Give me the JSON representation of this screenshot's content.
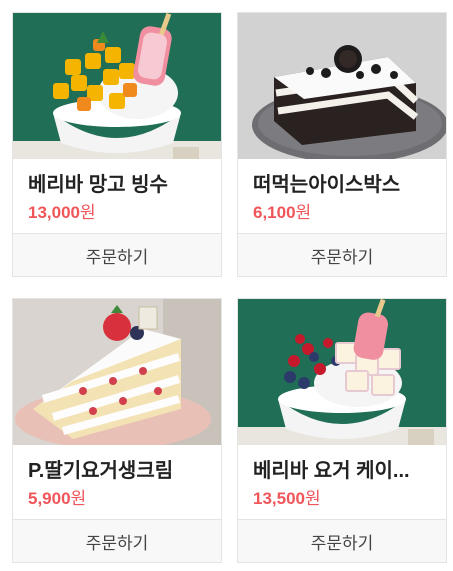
{
  "products": [
    {
      "name": "베리바 망고 빙수",
      "price": "13,000",
      "currency": "원",
      "order_label": "주문하기",
      "image": "mango-bingsu-image"
    },
    {
      "name": "떠먹는아이스박스",
      "price": "6,100",
      "currency": "원",
      "order_label": "주문하기",
      "image": "icebox-cake-image"
    },
    {
      "name": "P.딸기요거생크림",
      "price": "5,900",
      "currency": "원",
      "order_label": "주문하기",
      "image": "strawberry-cream-cake-image"
    },
    {
      "name": "베리바 요거 케이...",
      "price": "13,500",
      "currency": "원",
      "order_label": "주문하기",
      "image": "berry-yogurt-bingsu-image"
    }
  ],
  "colors": {
    "price": "#f0555a",
    "green_bg": "#1f6e55",
    "gray_bg": "#cfcfcf",
    "border": "#e4e4e4"
  }
}
